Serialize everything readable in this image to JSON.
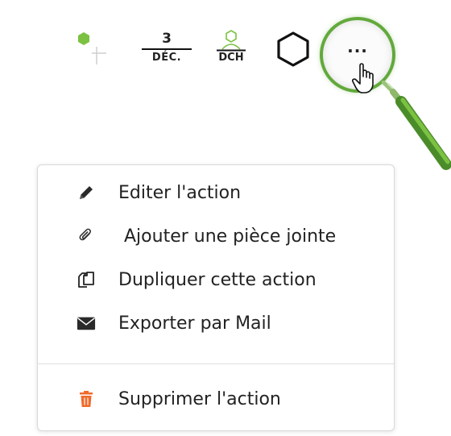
{
  "toolbar": {
    "date": {
      "day": "3",
      "month": "DÉC."
    },
    "dch": {
      "label": "DCH"
    },
    "more_button": {
      "label": "···"
    }
  },
  "menu": {
    "items": [
      {
        "label": "Editer l'action",
        "icon": "pencil-icon"
      },
      {
        "label": "Ajouter une pièce jointe",
        "icon": "paperclip-icon"
      },
      {
        "label": "Dupliquer cette action",
        "icon": "copy-icon"
      },
      {
        "label": "Exporter par Mail",
        "icon": "envelope-icon"
      }
    ],
    "delete": {
      "label": "Supprimer l'action",
      "icon": "trash-icon"
    }
  },
  "colors": {
    "accent_green": "#62a93c",
    "delete_icon": "#f06a2a",
    "text": "#222222"
  }
}
